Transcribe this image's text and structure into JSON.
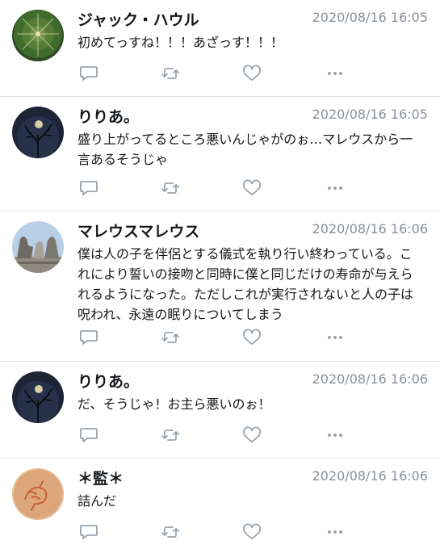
{
  "tweets": [
    {
      "name": "ジャック・ハウル",
      "time": "2020/08/16 16:05",
      "text": "初めてっすね！！！あざっす！！！",
      "avatar_icon": "cactus-avatar-icon"
    },
    {
      "name": "りりあ。",
      "time": "2020/08/16 16:05",
      "text": "盛り上がってるところ悪いんじゃがのぉ…マレウスから一言あるそうじゃ",
      "avatar_icon": "moon-tree-avatar-icon"
    },
    {
      "name": "マレウスマレウス",
      "time": "2020/08/16 16:06",
      "text": "僕は人の子を伴侶とする儀式を執り行い終わっている。これにより誓いの接吻と同時に僕と同じだけの寿命が与えられるようになった。ただしこれが実行されないと人の子は呪われ、永遠の眠りについてしまう",
      "avatar_icon": "gargoyle-avatar-icon"
    },
    {
      "name": "りりあ。",
      "time": "2020/08/16 16:06",
      "text": "だ、そうじゃ！お主ら悪いのぉ！",
      "avatar_icon": "moon-tree-avatar-icon"
    },
    {
      "name": "＊監＊",
      "time": "2020/08/16 16:06",
      "text": "詰んだ",
      "avatar_icon": "sketch-avatar-icon"
    }
  ],
  "action_icons": [
    "reply-icon",
    "retweet-icon",
    "like-icon",
    "more-icon"
  ],
  "colors": {
    "text": "#14171a",
    "meta": "#8a9199",
    "icon": "#99a3ad",
    "divider": "#e1e4e8"
  }
}
